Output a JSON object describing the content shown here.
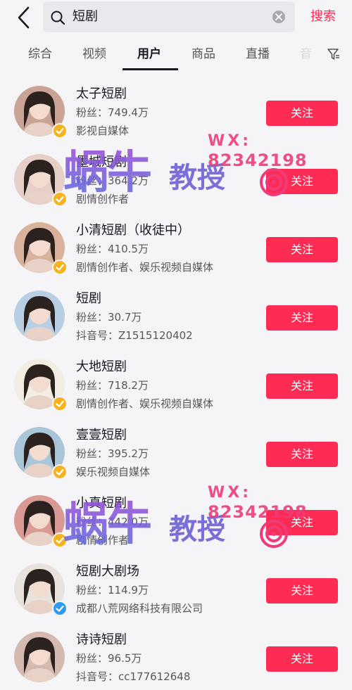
{
  "search": {
    "query": "短剧",
    "submit_label": "搜索"
  },
  "tabs": [
    {
      "label": "综合"
    },
    {
      "label": "视频"
    },
    {
      "label": "用户",
      "active": true
    },
    {
      "label": "商品"
    },
    {
      "label": "直播"
    },
    {
      "label": "音"
    }
  ],
  "users": [
    {
      "name": "太子短剧",
      "fans": "粉丝：749.4万",
      "desc": "影视自媒体",
      "verified": "gold",
      "follow_label": "关注",
      "avatar_color": "#c9a394"
    },
    {
      "name": "墨城短剧",
      "fans": "粉丝：364.2万",
      "desc": "剧情创作者",
      "verified": "gold",
      "follow_label": "关注",
      "avatar_color": "#e6cfc6"
    },
    {
      "name": "小清短剧（收徒中）",
      "fans": "粉丝：410.5万",
      "desc": "剧情创作者、娱乐视频自媒体",
      "verified": "gold",
      "follow_label": "关注",
      "avatar_color": "#d8b29a"
    },
    {
      "name": "短剧",
      "fans": "粉丝：30.7万",
      "desc": "抖音号：Z1515120402",
      "verified": "none",
      "follow_label": "关注",
      "avatar_color": "#b8cfe3"
    },
    {
      "name": "大地短剧",
      "fans": "粉丝：718.2万",
      "desc": "剧情创作者、娱乐视频自媒体",
      "verified": "gold",
      "follow_label": "关注",
      "avatar_color": "#f1ede2"
    },
    {
      "name": "壹壹短剧",
      "fans": "粉丝：395.2万",
      "desc": "娱乐视频自媒体",
      "verified": "gold",
      "follow_label": "关注",
      "avatar_color": "#a9c6d8"
    },
    {
      "name": "小真短剧",
      "fans": "粉丝：442.0万",
      "desc": "剧情创作者",
      "verified": "gold",
      "follow_label": "关注",
      "avatar_color": "#d99a94"
    },
    {
      "name": "短剧大剧场",
      "fans": "粉丝：114.9万",
      "desc": "成都八荒网络科技有限公司",
      "verified": "blue",
      "follow_label": "关注",
      "avatar_color": "#e7e3dc"
    },
    {
      "name": "诗诗短剧",
      "fans": "粉丝：96.5万",
      "desc": "抖音号：cc177612648",
      "verified": "none",
      "follow_label": "关注",
      "avatar_color": "#d3b9ae"
    }
  ],
  "watermark": {
    "main_text": "蜗牛",
    "sub_text": "教授",
    "wx_label": "WX:",
    "wx_number": "82342198"
  },
  "colors": {
    "accent": "#fe2c55",
    "badge_gold": "#f5b31f",
    "badge_blue": "#2e9bf3"
  },
  "icons": {
    "back": "chevron-left-icon",
    "search": "search-icon",
    "clear": "clear-icon",
    "filter": "filter-icon"
  }
}
